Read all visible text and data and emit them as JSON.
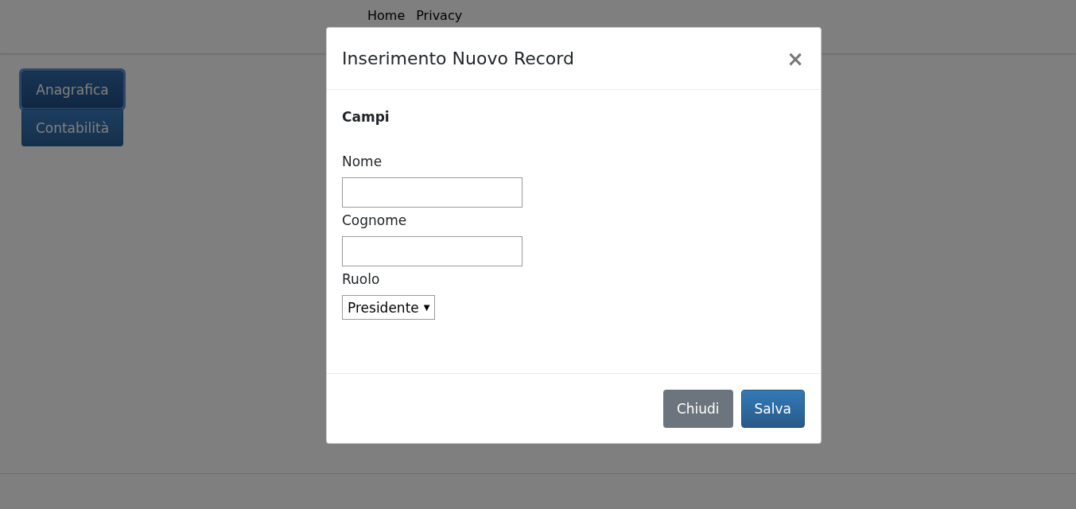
{
  "navbar": {
    "links": [
      {
        "label": "Home"
      },
      {
        "label": "Privacy"
      }
    ]
  },
  "sidebar": {
    "items": [
      {
        "label": "Anagrafica",
        "selected": true
      },
      {
        "label": "Contabilità",
        "selected": false
      }
    ]
  },
  "modal": {
    "title": "Inserimento Nuovo Record",
    "close": "×",
    "section": "Campi",
    "fields": [
      {
        "kind": "text",
        "label": "Nome"
      },
      {
        "kind": "text",
        "label": "Cognome"
      },
      {
        "kind": "select",
        "label": "Ruolo",
        "value": "Presidente",
        "caret": "▼"
      }
    ],
    "buttons": [
      {
        "label": "Chiudi",
        "kind": "secondary"
      },
      {
        "label": "Salva",
        "kind": "primary"
      }
    ]
  }
}
